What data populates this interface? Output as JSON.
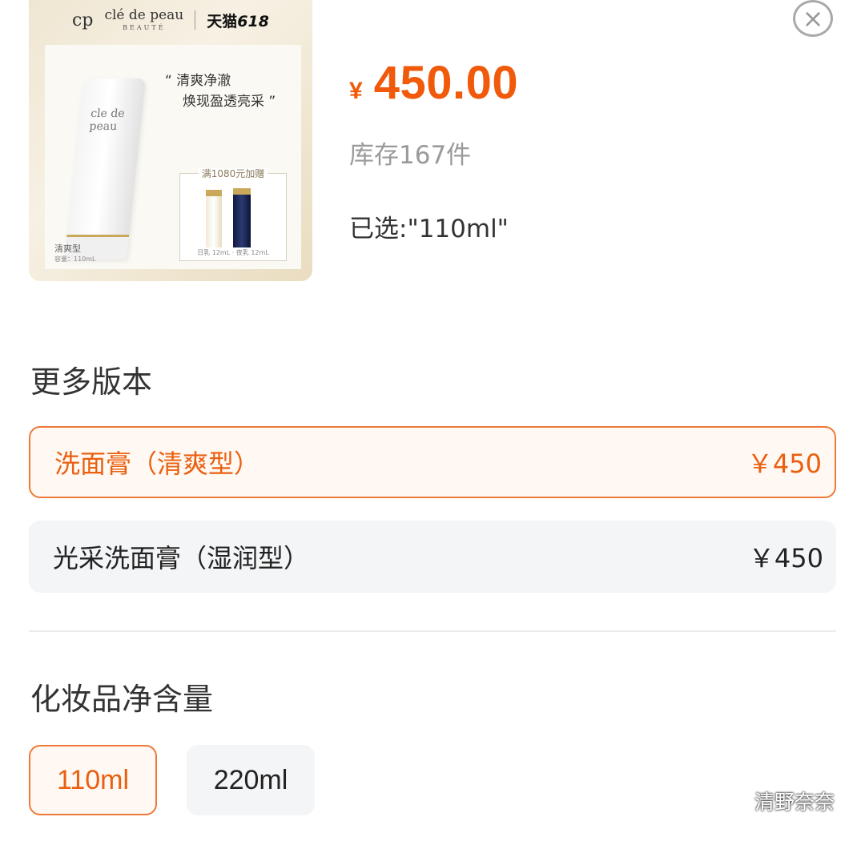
{
  "product_image": {
    "brand_name": "clé de peau",
    "brand_sub": "BEAUTÉ",
    "brand_mark": "cp",
    "tmall_text": "天猫",
    "tmall_618": "618",
    "quote_line1": "“ 清爽净澈",
    "quote_line2": "焕现盈透亮采 ”",
    "gift_title": "满1080元加赠",
    "gift_caption": "日乳 12mL · 夜乳 12mL",
    "type_caption": "清爽型",
    "size_caption": "容量：110mL",
    "tube_logo": "cle de peau"
  },
  "info": {
    "currency": "¥",
    "price": "450.00",
    "stock": "库存167件",
    "selected": "已选:\"110ml\""
  },
  "close": {
    "icon": "close-icon",
    "glyph": "×"
  },
  "versions": {
    "title": "更多版本",
    "items": [
      {
        "label": "洗面膏（清爽型）",
        "price": "￥450",
        "selected": true
      },
      {
        "label": "光采洗面膏（湿润型）",
        "price": "￥450",
        "selected": false
      }
    ]
  },
  "volume": {
    "title": "化妆品净含量",
    "options": [
      {
        "label": "110ml",
        "selected": true
      },
      {
        "label": "220ml",
        "selected": false
      }
    ]
  },
  "watermark": {
    "icon": "wechat-icon",
    "text": "清野奈奈"
  },
  "colors": {
    "accent": "#ea6010",
    "accent_border": "#ee7a3a",
    "accent_bg": "#fff8f3",
    "chip_bg": "#f4f5f7",
    "stock_text": "#9a9a9a"
  }
}
